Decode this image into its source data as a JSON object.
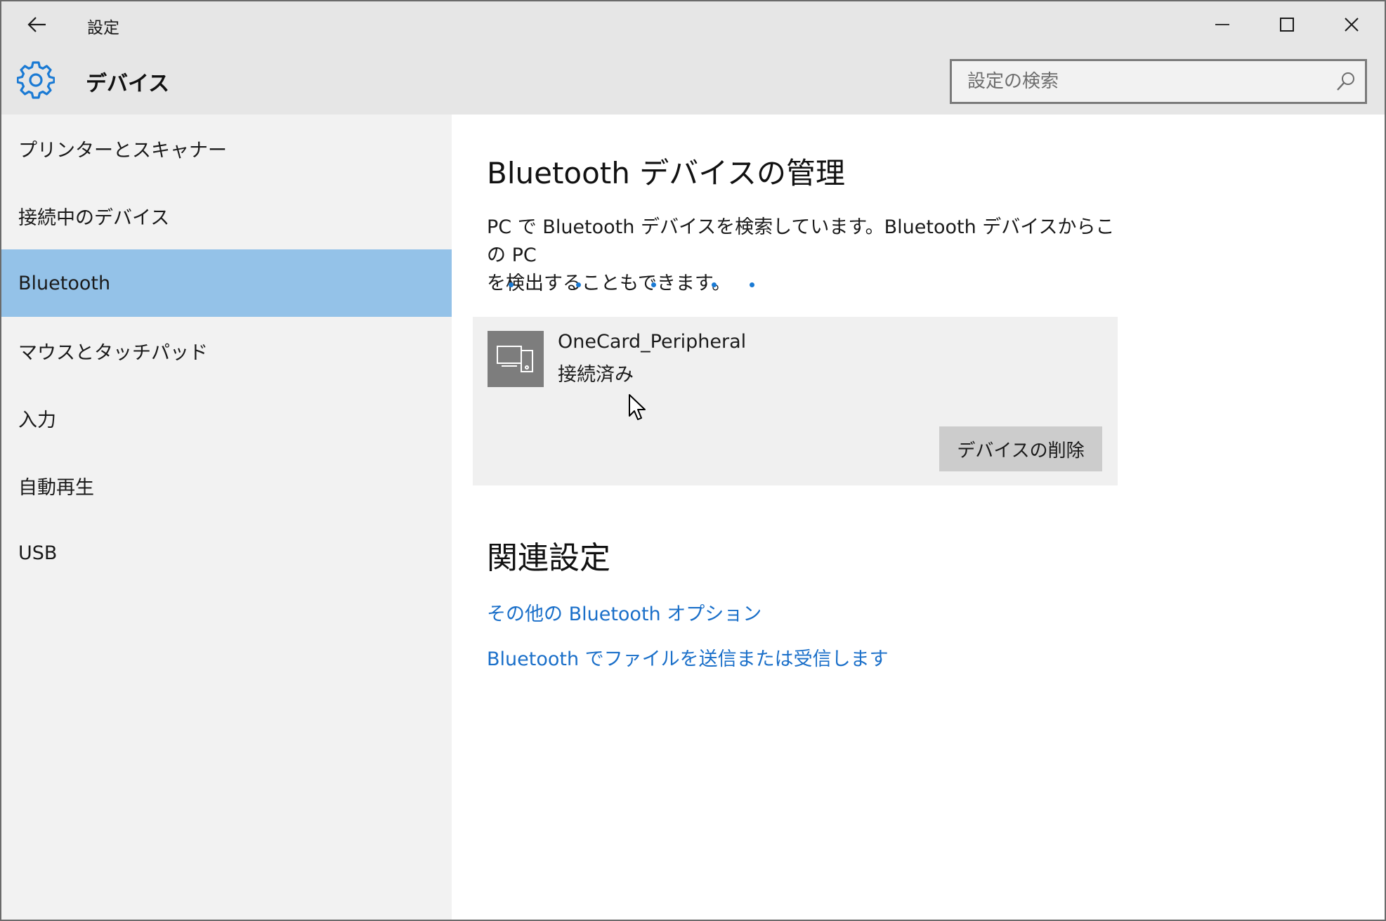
{
  "window": {
    "app_title": "設定",
    "controls": {
      "minimize": "minimize-icon",
      "maximize": "maximize-icon",
      "close": "close-icon"
    }
  },
  "header": {
    "title": "デバイス",
    "icon": "gear-icon",
    "search": {
      "placeholder": "設定の検索",
      "value": ""
    }
  },
  "sidebar": {
    "items": [
      {
        "label": "プリンターとスキャナー",
        "selected": false
      },
      {
        "label": "接続中のデバイス",
        "selected": false
      },
      {
        "label": "Bluetooth",
        "selected": true
      },
      {
        "label": "マウスとタッチパッド",
        "selected": false
      },
      {
        "label": "入力",
        "selected": false
      },
      {
        "label": "自動再生",
        "selected": false
      },
      {
        "label": "USB",
        "selected": false
      }
    ]
  },
  "main": {
    "title": "Bluetooth デバイスの管理",
    "description_line1": "PC で Bluetooth デバイスを検索しています。Bluetooth デバイスからこの PC",
    "description_line2": "を検出することもできます。",
    "device": {
      "name": "OneCard_Peripheral",
      "status": "接続済み",
      "remove_label": "デバイスの削除"
    },
    "related": {
      "title": "関連設定",
      "links": [
        "その他の Bluetooth オプション",
        "Bluetooth でファイルを送信または受信します"
      ]
    }
  },
  "colors": {
    "accent": "#1a6fc9",
    "selected_nav": "#94c2e8",
    "header_bg": "#e6e6e6",
    "sidebar_bg": "#f2f2f2",
    "card_bg": "#f0f0f0",
    "button_bg": "#cccccc"
  }
}
